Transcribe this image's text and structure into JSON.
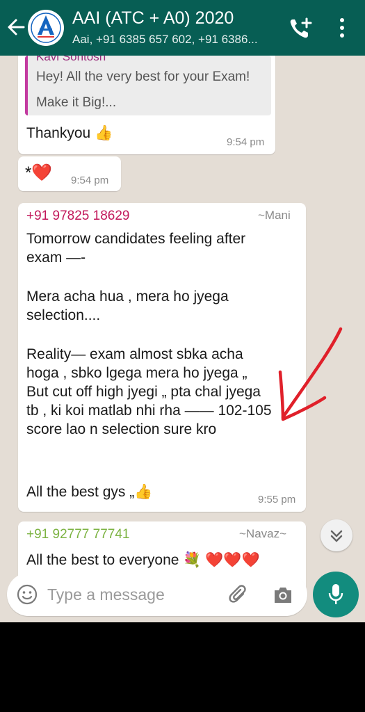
{
  "header": {
    "title": "AAI (ATC + A0) 2020",
    "subtitle": "Aai, +91 6385 657 602, +91 6386...",
    "back_icon": "back-arrow-icon",
    "call_icon": "add-call-icon",
    "menu_icon": "more-vert-icon"
  },
  "messages": {
    "quoted": {
      "sender": "Kavi Sontosh",
      "line1": "Hey! All the very best for your Exam!",
      "line2": "Make it Big!..."
    },
    "reply": {
      "text": "Thankyou 👍",
      "time": "9:54 pm"
    },
    "heart": {
      "text": "*❤️",
      "time": "9:54 pm"
    },
    "long": {
      "sender_number": "+91 97825 18629",
      "sender_name": "~Mani",
      "sender_color": "#c2185b",
      "lines": [
        "Tomorrow candidates feeling after",
        "exam —-",
        "Mera acha hua , mera ho jyega",
        "selection....",
        "Reality— exam almost sbka acha",
        "hoga , sbko lgega mera ho jyega „",
        "But cut off high jyegi „ pta chal jyega",
        "tb , ki koi matlab nhi rha —— 102-105",
        "score lao n selection sure kro",
        "All the best gys „👍"
      ],
      "time": "9:55 pm"
    },
    "last": {
      "sender_number": "+91 92777 77741",
      "sender_name": "~Navaz~",
      "sender_color": "#7cb342",
      "text": "All the best to everyone 💐 ❤️❤️❤️"
    }
  },
  "input": {
    "placeholder": "Type a message",
    "emoji_icon": "emoji-icon",
    "attach_icon": "attach-icon",
    "camera_icon": "camera-icon",
    "mic_icon": "mic-icon"
  },
  "colors": {
    "header": "#075e54",
    "mic": "#128c7e",
    "chat_bg": "#e4ddd5",
    "annotation": "#e0202a"
  }
}
